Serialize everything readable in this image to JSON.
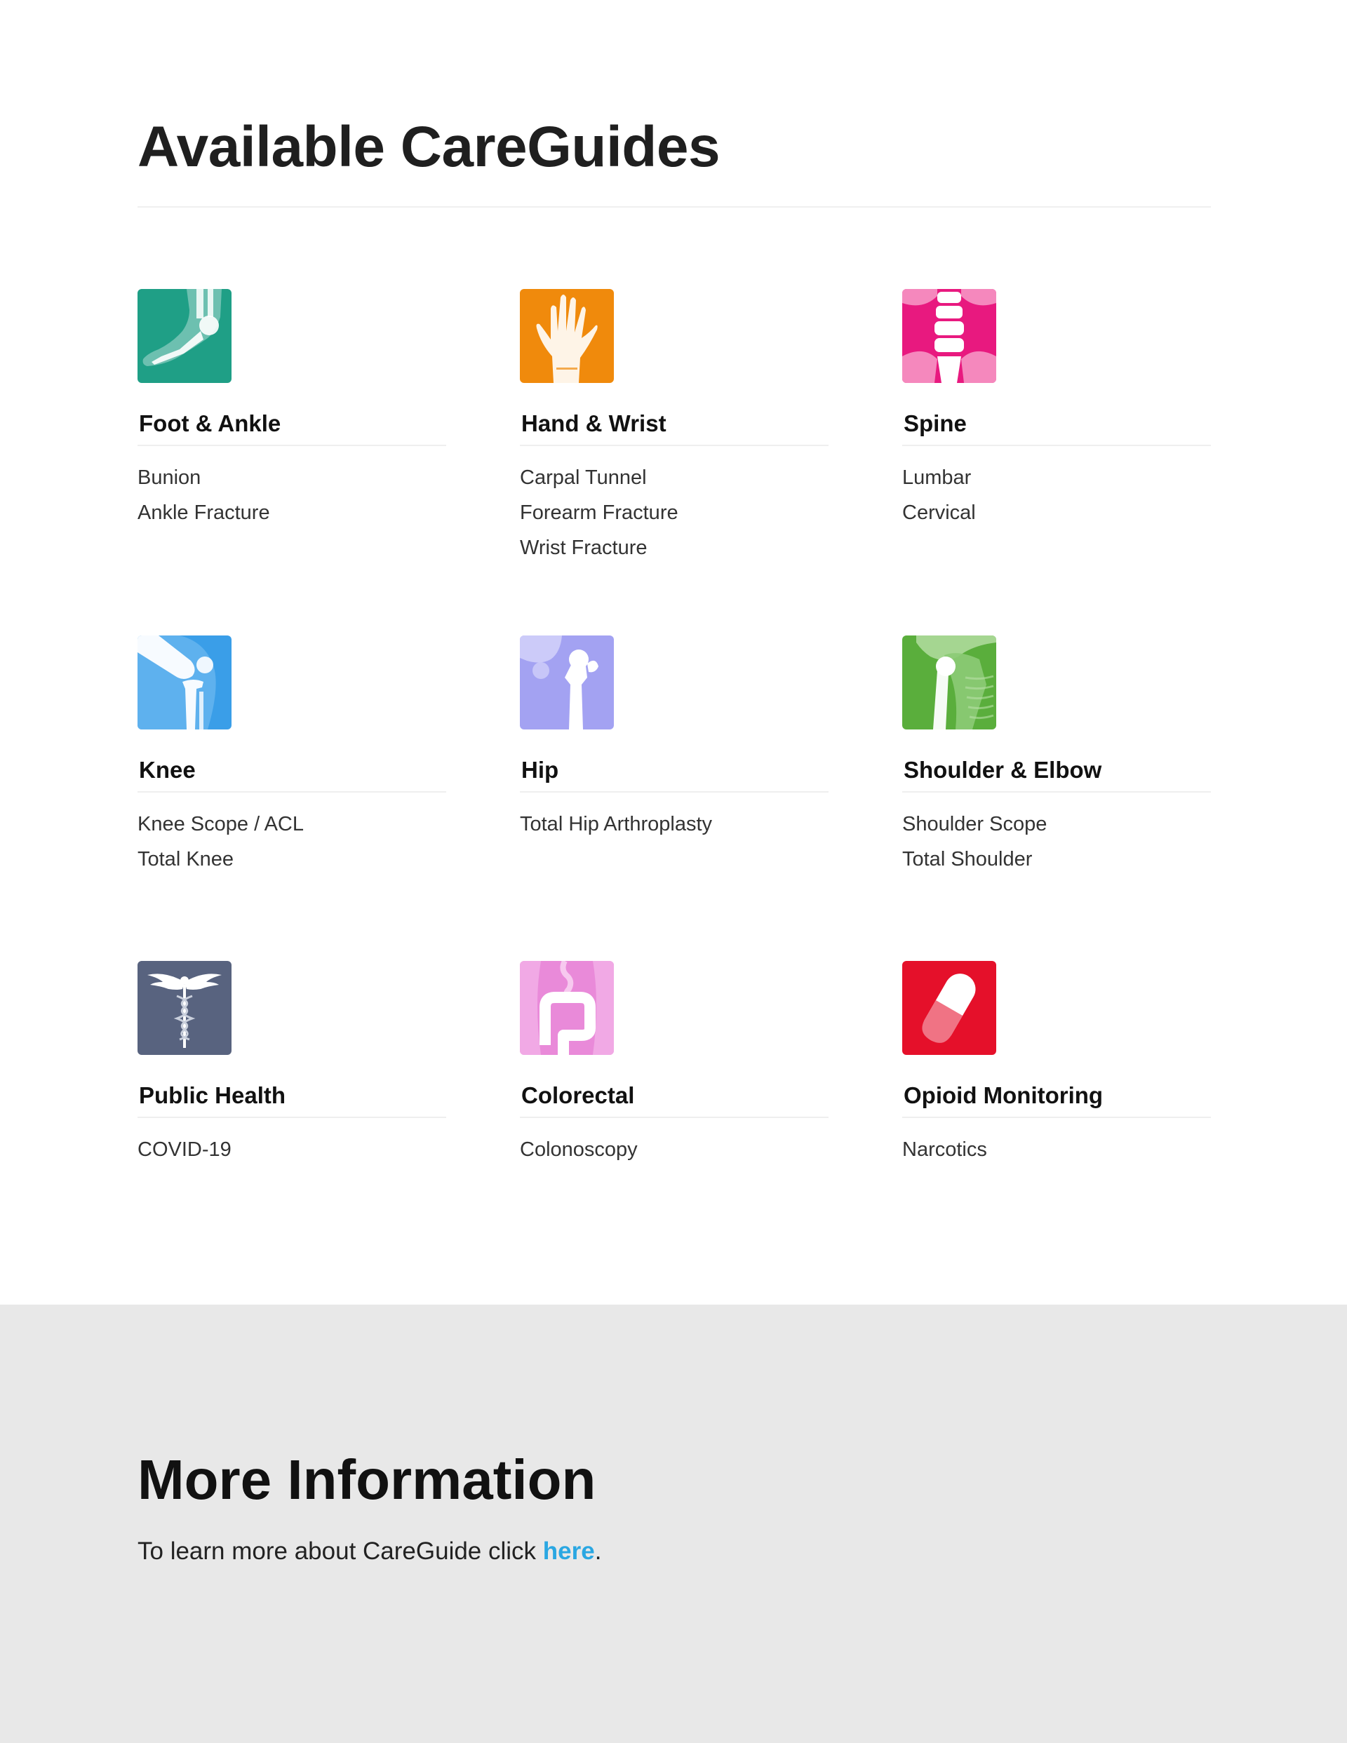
{
  "header": {
    "title": "Available CareGuides"
  },
  "categories": [
    {
      "title": "Foot & Ankle",
      "icon": "foot-ankle-xray-icon",
      "color": "#1f9f86",
      "links": [
        "Bunion",
        "Ankle Fracture"
      ]
    },
    {
      "title": "Hand & Wrist",
      "icon": "hand-wrist-xray-icon",
      "color": "#f08a0c",
      "links": [
        "Carpal Tunnel",
        "Forearm Fracture",
        "Wrist Fracture"
      ]
    },
    {
      "title": "Spine",
      "icon": "spine-xray-icon",
      "color": "#e8197f",
      "links": [
        "Lumbar",
        "Cervical"
      ]
    },
    {
      "title": "Knee",
      "icon": "knee-xray-icon",
      "color": "#3a9ee8",
      "links": [
        "Knee Scope / ACL",
        "Total Knee"
      ]
    },
    {
      "title": "Hip",
      "icon": "hip-xray-icon",
      "color": "#a3a2f2",
      "links": [
        "Total Hip Arthroplasty"
      ]
    },
    {
      "title": "Shoulder & Elbow",
      "icon": "shoulder-xray-icon",
      "color": "#5aae3c",
      "links": [
        "Shoulder Scope",
        "Total Shoulder"
      ]
    },
    {
      "title": "Public Health",
      "icon": "caduceus-icon",
      "color": "#58637f",
      "links": [
        "COVID-19"
      ]
    },
    {
      "title": "Colorectal",
      "icon": "colon-icon",
      "color": "#e98ad9",
      "links": [
        "Colonoscopy"
      ]
    },
    {
      "title": "Opioid Monitoring",
      "icon": "pill-capsule-icon",
      "color": "#e5102a",
      "links": [
        "Narcotics"
      ]
    }
  ],
  "more_info": {
    "title": "More Information",
    "text_before": "To learn more about CareGuide click ",
    "link_text": "here",
    "text_after": ".",
    "link_color": "#2aa7e2"
  }
}
